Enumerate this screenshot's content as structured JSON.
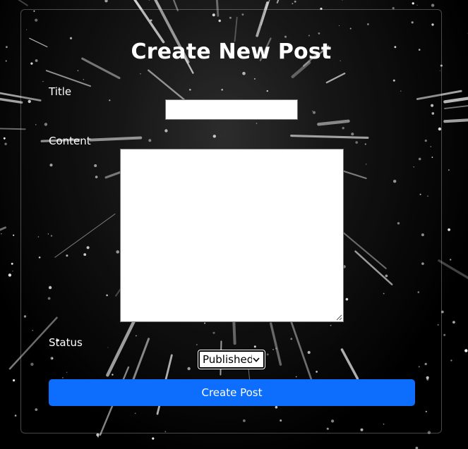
{
  "form": {
    "heading": "Create New Post",
    "title_label": "Title",
    "title_value": "",
    "content_label": "Content",
    "content_value": "",
    "status_label": "Status",
    "status_selected": "Published",
    "submit_label": "Create Post"
  },
  "colors": {
    "accent": "#0d6efd",
    "text": "#ffffff",
    "background": "#000000"
  },
  "icons": {
    "select_arrow": "chevron-down-icon",
    "resize_grip": "resize-grip-icon"
  }
}
